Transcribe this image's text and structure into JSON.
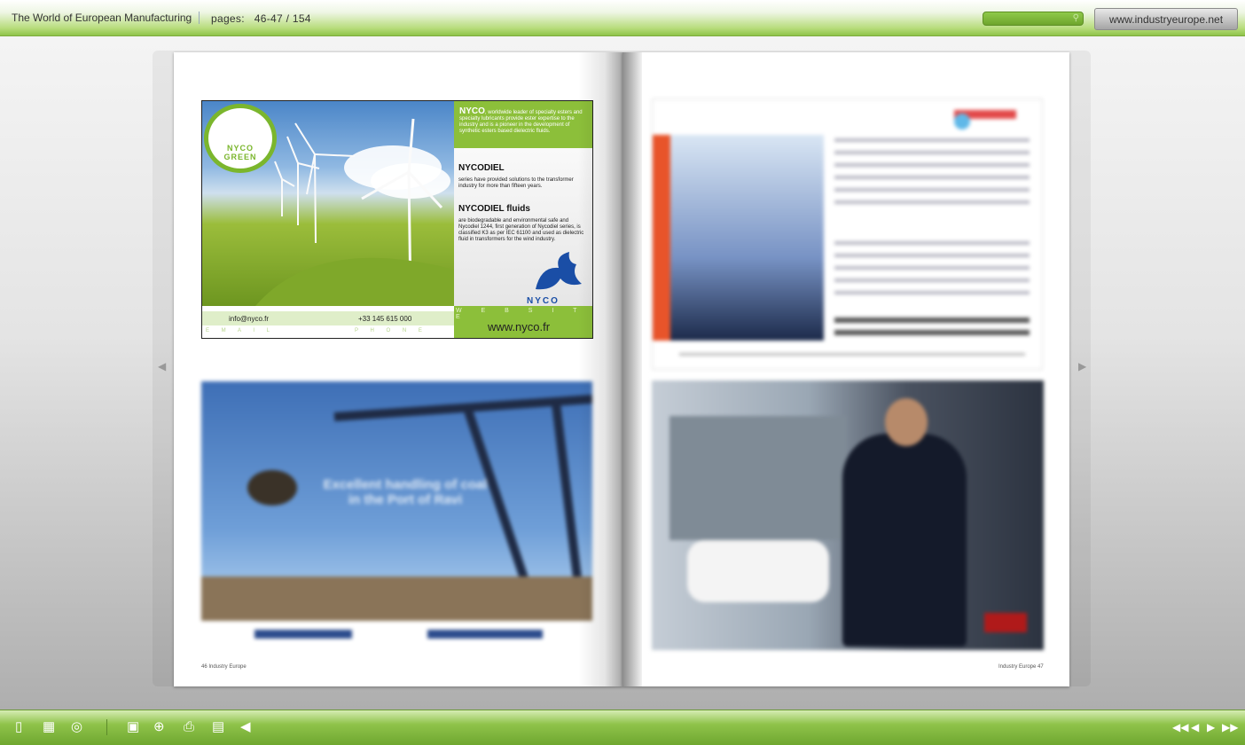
{
  "header": {
    "title": "The World of European Manufacturing",
    "pages_label": "pages:",
    "pages_value": "46-47 / 154",
    "site_button": "www.industryeurope.net",
    "search_icon": "search-icon"
  },
  "left_page": {
    "nyco_ad": {
      "logo_line1": "NYCO",
      "logo_line2": "GREEN",
      "intro_brand": "NYCO",
      "intro_text": ", worldwide leader of specialty esters and specialty lubricants provide ester expertise to the industry and is a pioneer in the development of synthetic esters based dielectric fluids.",
      "heading1": "NYCODIEL",
      "text1": "series have provided solutions to the transformer industry for more than fifteen years.",
      "heading2": "NYCODIEL fluids",
      "text2": "are biodegradable and environmental safe and Nycodiel 1244, first generation of Nycodiel series, is classified K3 as per IEC 61100 and used as dielectric fluid in transformers for the wind industry.",
      "brand": "NYCO",
      "email": "info@nyco.fr",
      "email_label": "E M A I L",
      "phone": "+33 145 615 000",
      "phone_label": "P H O N E",
      "website_label": "W E B S I T E",
      "website": "www.nyco.fr"
    },
    "crane_ad_slogan": "Excellent handling of coal in the Port of Ravi",
    "folio": "46  Industry Europe"
  },
  "right_page": {
    "folio": "Industry Europe  47"
  },
  "toolbar": {
    "left_icons": [
      "single-page-icon",
      "thumbnails-icon",
      "share-icon",
      "fullscreen-icon",
      "zoom-icon",
      "print-icon",
      "save-icon",
      "sound-icon"
    ],
    "right_icons": [
      "first-page-icon",
      "previous-page-icon",
      "next-page-icon",
      "last-page-icon"
    ]
  },
  "colors": {
    "accent_green": "#8cbf3a",
    "nyco_blue": "#1a4ea6"
  }
}
